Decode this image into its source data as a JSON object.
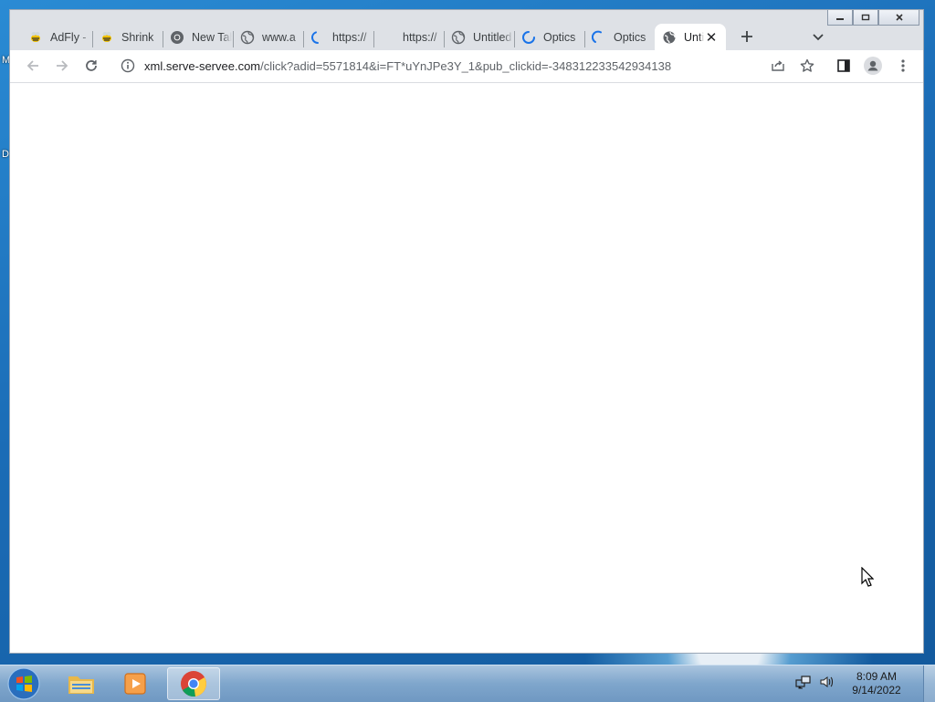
{
  "desktop": {
    "labels": [
      "M",
      "D"
    ]
  },
  "browser": {
    "tabs": [
      {
        "title": "AdFly -",
        "icon": "bee-icon",
        "loading": false
      },
      {
        "title": "Shrink",
        "icon": "bee-icon",
        "loading": false
      },
      {
        "title": "New Tab",
        "icon": "chrome-icon",
        "loading": false
      },
      {
        "title": "www.a",
        "icon": "globe-icon",
        "loading": false
      },
      {
        "title": "https://",
        "icon": "spinner-icon",
        "loading": true
      },
      {
        "title": "https://",
        "icon": "blank-icon",
        "loading": false
      },
      {
        "title": "Untitled",
        "icon": "globe-icon",
        "loading": false
      },
      {
        "title": "Optics",
        "icon": "spinner-icon",
        "loading": true
      },
      {
        "title": "Optics",
        "icon": "spinner-icon",
        "loading": true
      },
      {
        "title": "Untitled",
        "icon": "globe-icon",
        "loading": false,
        "active": true
      }
    ],
    "address": {
      "host": "xml.serve-servee.com",
      "path": "/click?adid=5571814&i=FT*uYnJPe3Y_1&pub_clickid=-348312233542934138"
    }
  },
  "taskbar": {
    "apps": [
      {
        "name": "Windows Explorer",
        "icon": "folder-icon"
      },
      {
        "name": "Windows Media Player",
        "icon": "media-player-icon"
      },
      {
        "name": "Google Chrome",
        "icon": "chrome-icon",
        "active": true
      }
    ],
    "clock": {
      "time": "8:09 AM",
      "date": "9/14/2022"
    }
  }
}
